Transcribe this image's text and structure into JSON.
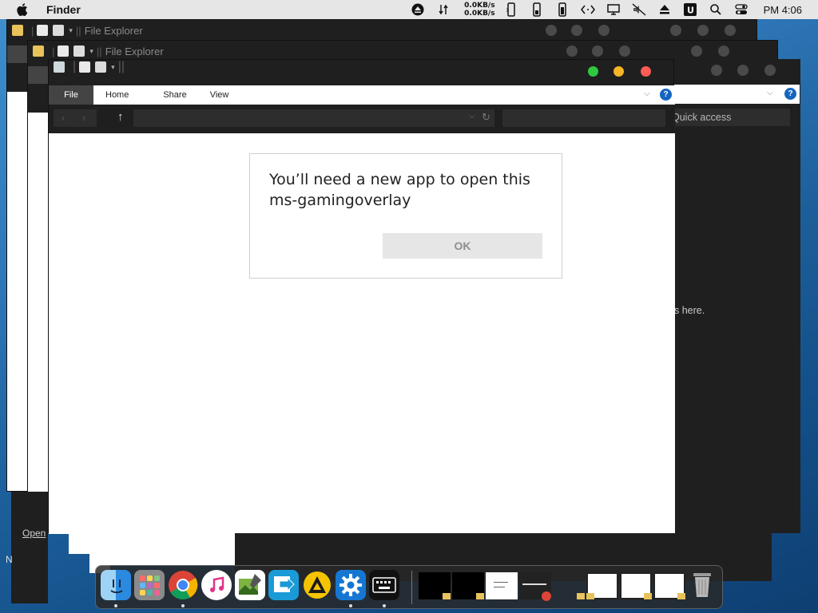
{
  "menubar": {
    "app_name": "Finder",
    "net_up": "0.0KB/s",
    "net_down": "0.0KB/s",
    "clock": "PM 4:06",
    "icons": [
      "apple-icon",
      "eject-icon",
      "network-arrows-icon",
      "phone-icon",
      "phone-icon",
      "phone-icon",
      "code-icon",
      "display-icon",
      "mute-icon",
      "eject-icon",
      "u-app-icon",
      "search-icon",
      "control-center-icon"
    ]
  },
  "windows": {
    "back1_title": "File Explorer",
    "back2_title": "File Explorer",
    "front_title": "File Explorer",
    "back_quick_access": "Quick access",
    "back_hint": "s here.",
    "open_label": "Open",
    "n_label": "N"
  },
  "ribbon": {
    "tabs": [
      "File",
      "Home",
      "Share",
      "View"
    ],
    "help": "?"
  },
  "dialog": {
    "message": "You’ll need a new app to open this ms-gamingoverlay",
    "ok_label": "OK"
  },
  "colors": {
    "traffic_green": "#2fc840",
    "traffic_yellow": "#f6b625",
    "traffic_red": "#fd5d55",
    "help_blue": "#1565c0"
  },
  "dock": {
    "apps": [
      "finder-icon",
      "launchpad-icon",
      "chrome-icon",
      "music-icon",
      "image-editor-icon",
      "remote-desktop-icon",
      "app-a-icon",
      "settings-icon",
      "keyboard-icon"
    ],
    "windows": [
      "explorer-thumb-1",
      "explorer-thumb-2",
      "document-thumb",
      "chrome-thumb",
      "explorer-thumb-3",
      "explorer-thumb-4",
      "explorer-thumb-5"
    ],
    "trash": "trash-icon"
  }
}
